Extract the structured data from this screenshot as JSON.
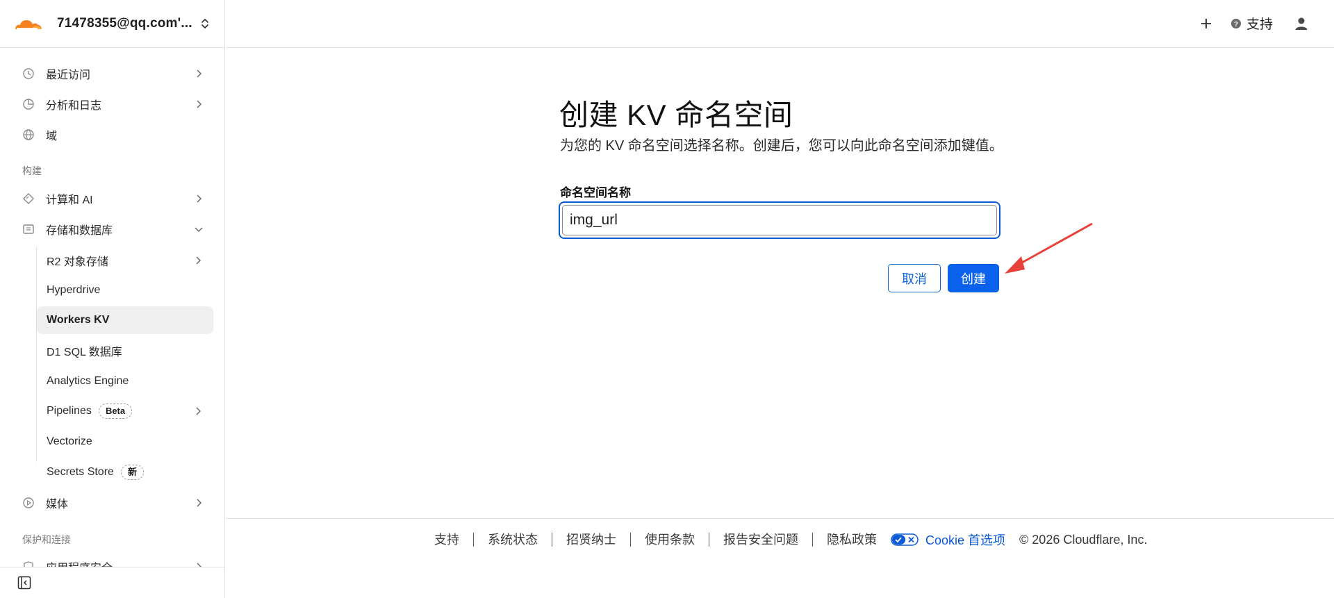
{
  "account": {
    "name": "71478355@qq.com'..."
  },
  "sidebar": {
    "items": [
      {
        "label": "最近访问",
        "icon": "clock-icon"
      },
      {
        "label": "分析和日志",
        "icon": "pie-chart-icon"
      },
      {
        "label": "域",
        "icon": "globe-icon"
      },
      {
        "label": "计算和 AI",
        "icon": "diamond-icon"
      },
      {
        "label": "存储和数据库",
        "icon": "database-icon"
      },
      {
        "label": "媒体",
        "icon": "play-circle-icon"
      }
    ],
    "sections": {
      "build": "构建",
      "protect": "保护和连接"
    },
    "sub_items": [
      {
        "label": "R2 对象存储"
      },
      {
        "label": "Hyperdrive"
      },
      {
        "label": "Workers KV"
      },
      {
        "label": "D1 SQL 数据库"
      },
      {
        "label": "Analytics Engine"
      },
      {
        "label": "Pipelines",
        "badge": "Beta"
      },
      {
        "label": "Vectorize"
      },
      {
        "label": "Secrets Store",
        "badge": "新"
      }
    ],
    "partial_item": "应用程序安全"
  },
  "topbar": {
    "support": "支持"
  },
  "main": {
    "title": "创建 KV 命名空间",
    "subtitle": "为您的 KV 命名空间选择名称。创建后，您可以向此命名空间添加键值。",
    "field_label": "命名空间名称",
    "field_value": "img_url",
    "cancel": "取消",
    "create": "创建"
  },
  "footer": {
    "links": [
      "支持",
      "系统状态",
      "招贤纳士",
      "使用条款",
      "报告安全问题",
      "隐私政策"
    ],
    "cookie": "Cookie 首选项",
    "copyright": "© 2026 Cloudflare, Inc."
  },
  "colors": {
    "accent": "#0a62ec",
    "arrow": "#e8413a",
    "logo": "#f6821f"
  }
}
